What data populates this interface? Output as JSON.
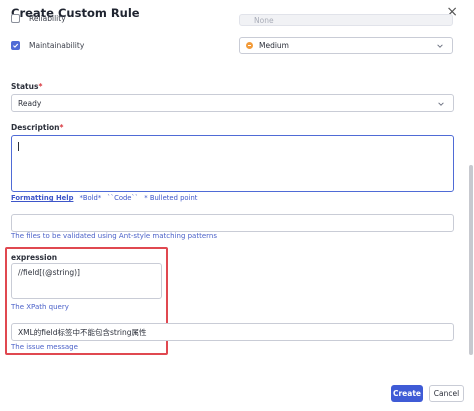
{
  "dialog": {
    "title": "Create Custom Rule",
    "close_icon": "close-icon"
  },
  "qualities": [
    {
      "label": "Reliability",
      "checked": false,
      "severity": "None",
      "disabled": true
    },
    {
      "label": "Maintainability",
      "checked": true,
      "severity": "Medium",
      "disabled": false
    }
  ],
  "status": {
    "label": "Status",
    "required": "*",
    "value": "Ready"
  },
  "description": {
    "label": "Description",
    "required": "*",
    "value": ""
  },
  "formatting_help": {
    "link": "Formatting Help",
    "bold": "*Bold*",
    "code": "``Code``",
    "bullet": "* Bulleted point"
  },
  "path_patterns": {
    "value": "",
    "hint": "The files to be validated using Ant-style matching patterns"
  },
  "expression": {
    "label": "expression",
    "value": "//field[(@string)]",
    "hint": "The XPath query"
  },
  "message": {
    "value": "XML的field标签中不能包含string属性",
    "hint": "The issue message"
  },
  "buttons": {
    "create": "Create",
    "cancel": "Cancel"
  },
  "colors": {
    "accent": "#3f5bd6",
    "required": "#d9383f",
    "highlight": "#e04850",
    "severity_medium": "#f29b3a"
  }
}
